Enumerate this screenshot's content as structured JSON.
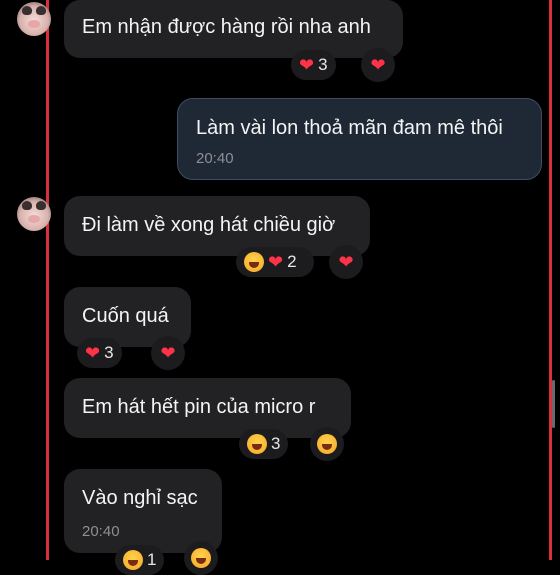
{
  "messages": [
    {
      "text": "Em nhận được hàng rồi nha anh",
      "reactions": [
        {
          "emoji": "heart",
          "count": "3"
        }
      ],
      "my_reaction": "heart"
    },
    {
      "text": "Làm vài lon thoả mãn đam mê thôi",
      "time": "20:40"
    },
    {
      "text": "Đi làm về xong hát chiều giờ",
      "reactions": [
        {
          "emoji": "laugh"
        },
        {
          "emoji": "heart",
          "count": "2"
        }
      ],
      "my_reaction": "heart"
    },
    {
      "text": "Cuốn quá",
      "reactions": [
        {
          "emoji": "heart",
          "count": "3"
        }
      ],
      "my_reaction": "heart"
    },
    {
      "text": "Em hát hết pin của micro r",
      "reactions": [
        {
          "emoji": "laugh",
          "count": "3"
        }
      ],
      "my_reaction": "laugh"
    },
    {
      "text": "Vào nghỉ sạc",
      "time": "20:40",
      "reactions": [
        {
          "emoji": "laugh",
          "count": "1"
        }
      ],
      "my_reaction": "laugh"
    }
  ],
  "colors": {
    "incoming_bubble": "#222224",
    "outgoing_bubble": "#1f2935",
    "frame_accent": "#d8303c",
    "heart": "#ff3347"
  },
  "icons": [
    "heart-icon",
    "laughing-face-icon",
    "avatar-icon"
  ]
}
